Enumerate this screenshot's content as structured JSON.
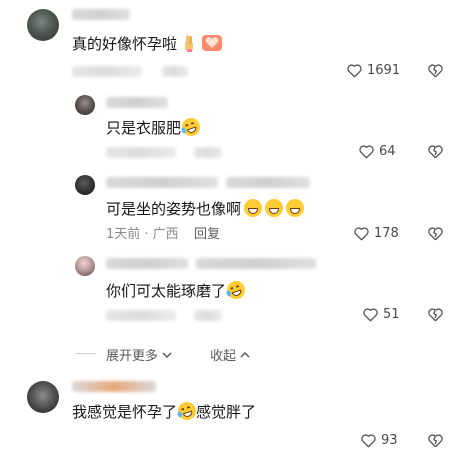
{
  "comments": [
    {
      "text": "真的好像怀孕啦",
      "likes": "1691"
    },
    {
      "text": "只是衣服肥",
      "likes": "64"
    },
    {
      "text": "可是坐的姿势也像啊",
      "meta": "1天前 · 广西",
      "reply_label": "回复",
      "likes": "178"
    },
    {
      "text": "你们可太能琢磨了",
      "likes": "51"
    },
    {
      "text_a": "我感觉是怀孕了",
      "text_b": "感觉胖了",
      "likes": "93"
    }
  ],
  "thread": {
    "expand_label": "展开更多",
    "collapse_label": "收起"
  },
  "colors": {
    "background": "#ffffff",
    "text": "#161616",
    "meta": "#8a8a8a",
    "emoji": "#ffcc33"
  }
}
